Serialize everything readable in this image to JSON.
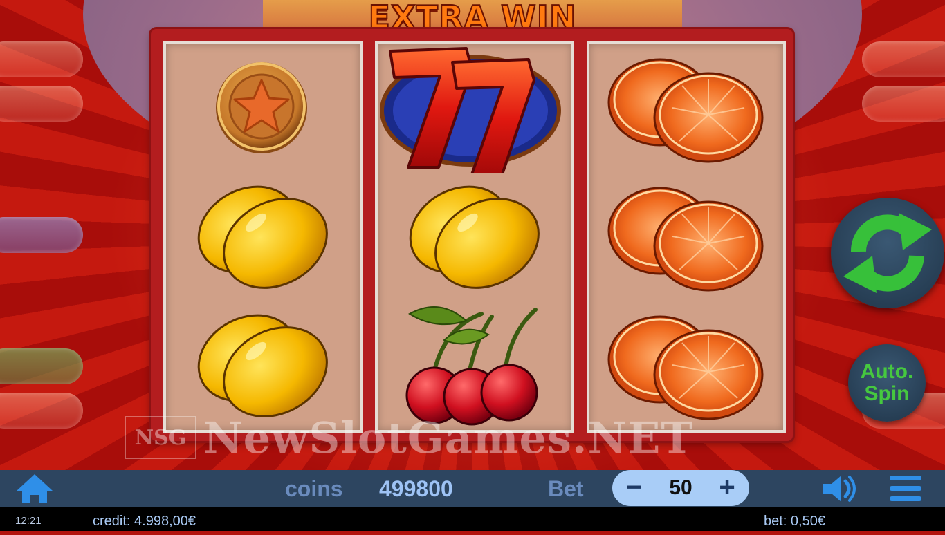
{
  "game": {
    "title": "EXTRA WIN"
  },
  "reels": [
    [
      "star-coin",
      "lemon",
      "lemon"
    ],
    [
      "seven",
      "lemon",
      "cherry"
    ],
    [
      "orange",
      "orange",
      "orange"
    ]
  ],
  "buttons": {
    "auto_spin_label": "Auto.\nSpin"
  },
  "watermark": {
    "logo": "NSG",
    "text": "NewSlotGames.NET"
  },
  "bottom_bar": {
    "coins_label": "coins",
    "coins_value": "499800",
    "bet_label": "Bet",
    "bet_value": "50",
    "minus": "−",
    "plus": "+"
  },
  "footer": {
    "clock": "12:21",
    "credit": "credit: 4.998,00€",
    "bet": "bet: 0,50€"
  },
  "colors": {
    "background": "#b3140f",
    "bar": "#2d4560",
    "spin_arrow": "#37c03a",
    "bet_control": "#a9cdf7"
  },
  "icons": [
    "home-icon",
    "sound-icon",
    "menu-icon",
    "spin-icon"
  ]
}
